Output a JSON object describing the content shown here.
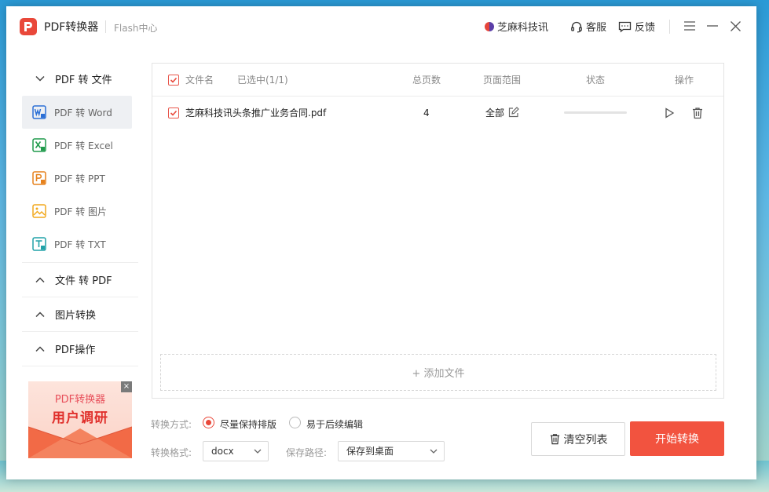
{
  "colors": {
    "accent": "#e9483a",
    "start_button": "#f2533f",
    "word": "#2b6fd6",
    "excel": "#1f9a4b",
    "ppt": "#e6811c",
    "image": "#f2a91e",
    "txt": "#21a2a8"
  },
  "app": {
    "title": "PDF转换器",
    "subtitle": "Flash中心"
  },
  "header": {
    "brand_label": "芝麻科技讯",
    "service_label": "客服",
    "feedback_label": "反馈",
    "icons": [
      "headset-icon",
      "chat-feedback-icon",
      "menu-icon",
      "minimize-icon",
      "close-icon"
    ]
  },
  "sidebar": {
    "group_pdf_to_file": "PDF 转 文件",
    "items": [
      {
        "label": "PDF 转 Word",
        "icon": "word-icon"
      },
      {
        "label": "PDF 转 Excel",
        "icon": "excel-icon"
      },
      {
        "label": "PDF 转 PPT",
        "icon": "ppt-icon"
      },
      {
        "label": "PDF 转 图片",
        "icon": "image-icon"
      },
      {
        "label": "PDF 转 TXT",
        "icon": "txt-icon"
      }
    ],
    "group_file_to_pdf": "文件 转 PDF",
    "group_image_convert": "图片转换",
    "group_pdf_ops": "PDF操作"
  },
  "promo": {
    "line1": "PDF转换器",
    "line2": "用户调研",
    "close": "×"
  },
  "table": {
    "col_filename": "文件名",
    "selected_count": "已选中(1/1)",
    "col_pages": "总页数",
    "col_range": "页面范围",
    "col_status": "状态",
    "col_actions": "操作",
    "rows": [
      {
        "filename": "芝麻科技讯头条推广业务合同.pdf",
        "pages": "4",
        "range": "全部",
        "progress": 0
      }
    ]
  },
  "add_file_label": "+ 添加文件",
  "options": {
    "mode_label": "转换方式:",
    "mode_option_1": "尽量保持排版",
    "mode_option_2": "易于后续编辑",
    "mode_selected": 1,
    "format_label": "转换格式:",
    "format_value": "docx",
    "path_label": "保存路径:",
    "path_value": "保存到桌面"
  },
  "buttons": {
    "clear_label": "清空列表",
    "start_label": "开始转换"
  }
}
